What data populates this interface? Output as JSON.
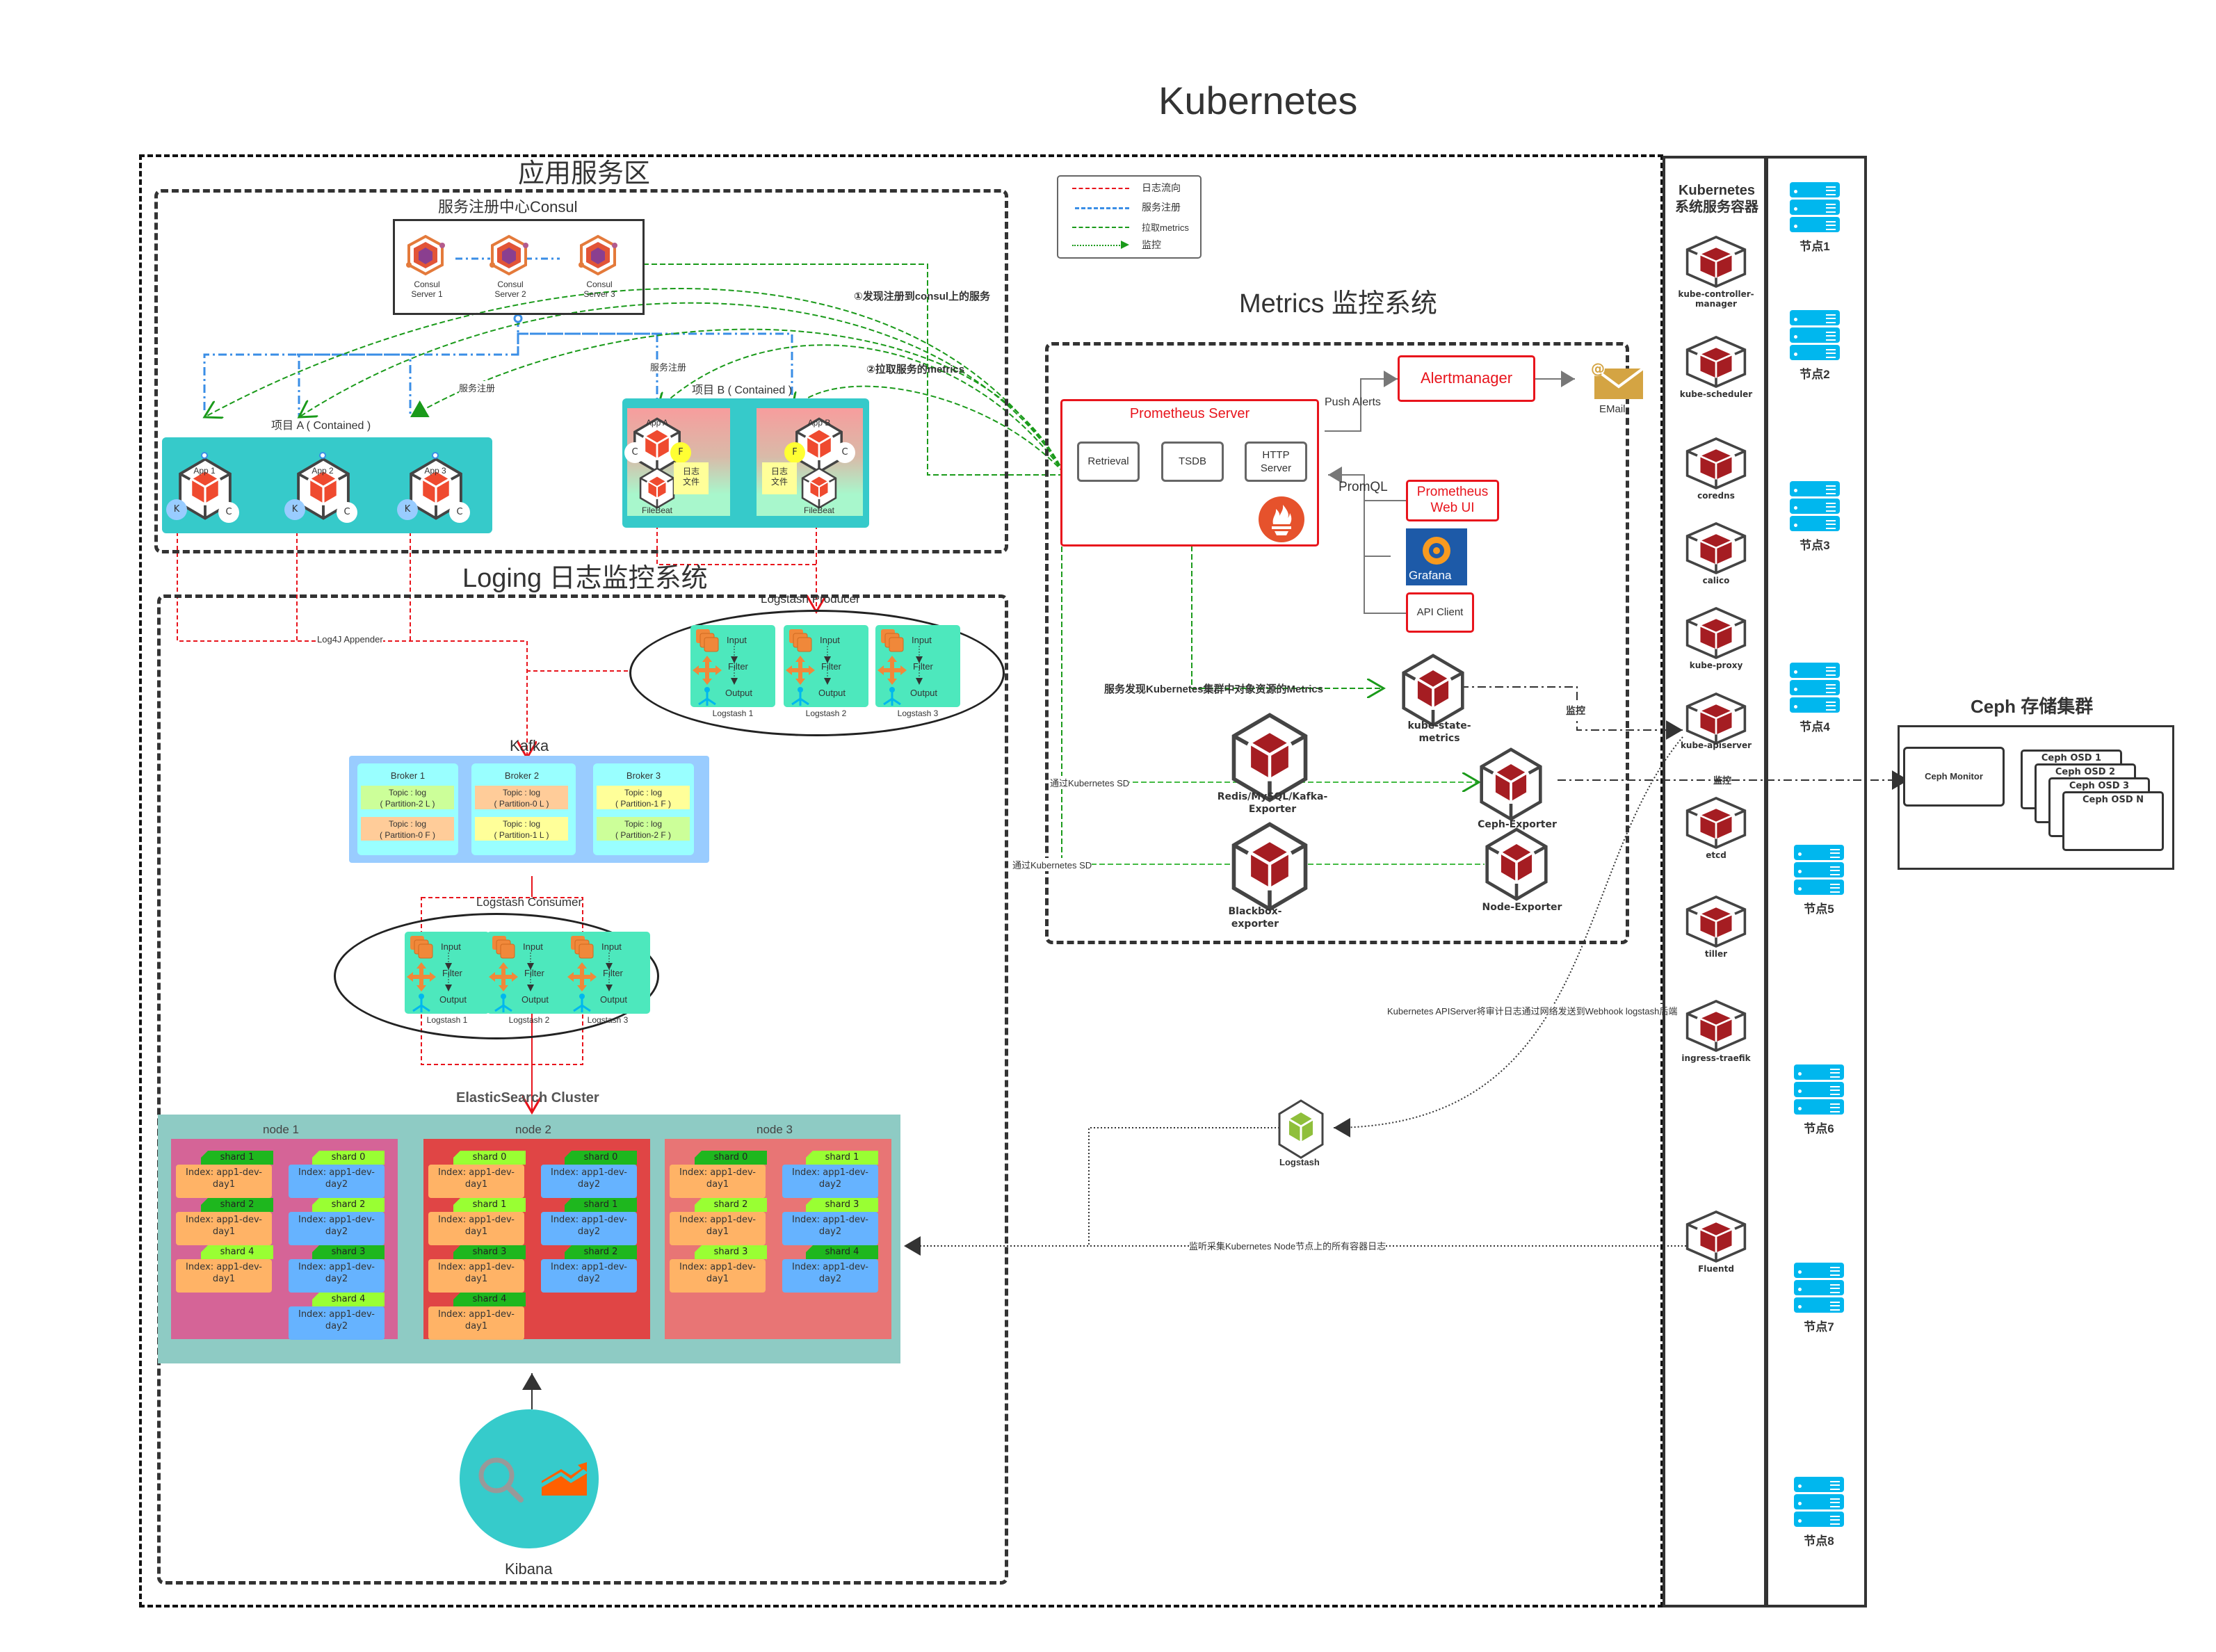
{
  "title": "Kubernetes",
  "legend": {
    "items": [
      {
        "label": "日志流向",
        "style": "red-dashed-arrow"
      },
      {
        "label": "服务注册",
        "style": "blue-dashdot-circles"
      },
      {
        "label": "拉取metrics",
        "style": "green-dashed-arrow"
      },
      {
        "label": "监控",
        "style": "green-dashdot-filled-arrow"
      }
    ]
  },
  "app_zone": {
    "title": "应用服务区",
    "consul": {
      "title": "服务注册中心Consul",
      "servers": [
        "Consul\nServer 1",
        "Consul\nServer 2",
        "Consul\nServer 3"
      ]
    },
    "register_label": "服务注册",
    "project_a": {
      "title": "项目 A ( Contained )",
      "apps": [
        "App 1",
        "App 2",
        "App 3"
      ],
      "badge_k": "K",
      "badge_c": "C"
    },
    "project_b": {
      "title": "项目 B ( Contained )",
      "apps": [
        "App A",
        "App B"
      ],
      "badge_c": "C",
      "badge_f": "F",
      "log_file": "日志\n文件",
      "filebeat": "FileBeat"
    },
    "annotation_1": "①发现注册到consul上的服务",
    "annotation_2": "②拉取服务的metrics"
  },
  "logging": {
    "title": "Loging 日志监控系统",
    "log4j": "Log4J Appender",
    "producer": {
      "title": "Logstash Producer",
      "instances": [
        "Logstash 1",
        "Logstash 2",
        "Logstash 3"
      ]
    },
    "pipeline": {
      "input": "Input",
      "filter": "Filter",
      "output": "Output"
    },
    "kafka": {
      "title": "Kafka",
      "brokers": [
        {
          "name": "Broker 1",
          "topics": [
            {
              "text": "Topic : log\n( Partition-2 L )",
              "color": "#ccff99"
            },
            {
              "text": "Topic : log\n( Partition-0 F )",
              "color": "#ffcc99"
            }
          ]
        },
        {
          "name": "Broker 2",
          "topics": [
            {
              "text": "Topic : log\n( Partition-0 L )",
              "color": "#ffcc99"
            },
            {
              "text": "Topic : log\n( Partition-1 L )",
              "color": "#ffff99"
            }
          ]
        },
        {
          "name": "Broker 3",
          "topics": [
            {
              "text": "Topic : log\n( Partition-1 F )",
              "color": "#ffff99"
            },
            {
              "text": "Topic : log\n( Partition-2 F )",
              "color": "#ccff99"
            }
          ]
        }
      ]
    },
    "consumer": {
      "title": "Logstash Consumer",
      "instances": [
        "Logstash 1",
        "Logstash 2",
        "Logstash 3"
      ]
    },
    "elasticsearch": {
      "title": "ElasticSearch Cluster",
      "nodes": [
        {
          "name": "node 1",
          "bg": "#d56497",
          "shards": [
            {
              "shard": "shard 1",
              "index": "Index: app1-dev-\nday1",
              "col": 0,
              "row": 0,
              "primary": true
            },
            {
              "shard": "shard 0",
              "index": "Index: app1-dev-\nday2",
              "col": 1,
              "row": 0,
              "primary": false
            },
            {
              "shard": "shard 2",
              "index": "Index: app1-dev-\nday1",
              "col": 0,
              "row": 1,
              "primary": true
            },
            {
              "shard": "shard 2",
              "index": "Index: app1-dev-\nday2",
              "col": 1,
              "row": 1,
              "primary": false
            },
            {
              "shard": "shard 4",
              "index": "Index: app1-dev-\nday1",
              "col": 0,
              "row": 2,
              "primary": false
            },
            {
              "shard": "shard 3",
              "index": "Index: app1-dev-\nday2",
              "col": 1,
              "row": 2,
              "primary": true
            },
            {
              "shard": "shard 4",
              "index": "Index: app1-dev-\nday2",
              "col": 1,
              "row": 3,
              "primary": false
            }
          ]
        },
        {
          "name": "node 2",
          "bg": "#e04545",
          "shards": [
            {
              "shard": "shard 0",
              "index": "Index: app1-dev-\nday1",
              "col": 0,
              "row": 0,
              "primary": false
            },
            {
              "shard": "shard 0",
              "index": "Index: app1-dev-\nday2",
              "col": 1,
              "row": 0,
              "primary": true
            },
            {
              "shard": "shard 1",
              "index": "Index: app1-dev-\nday1",
              "col": 0,
              "row": 1,
              "primary": false
            },
            {
              "shard": "shard 1",
              "index": "Index: app1-dev-\nday2",
              "col": 1,
              "row": 1,
              "primary": true
            },
            {
              "shard": "shard 3",
              "index": "Index: app1-dev-\nday1",
              "col": 0,
              "row": 2,
              "primary": true
            },
            {
              "shard": "shard 2",
              "index": "Index: app1-dev-\nday2",
              "col": 1,
              "row": 2,
              "primary": true
            },
            {
              "shard": "shard 4",
              "index": "Index: app1-dev-\nday1",
              "col": 0,
              "row": 3,
              "primary": true
            }
          ]
        },
        {
          "name": "node 3",
          "bg": "#e87575",
          "shards": [
            {
              "shard": "shard 0",
              "index": "Index: app1-dev-\nday1",
              "col": 0,
              "row": 0,
              "primary": true
            },
            {
              "shard": "shard 1",
              "index": "Index: app1-dev-\nday2",
              "col": 1,
              "row": 0,
              "primary": false
            },
            {
              "shard": "shard 2",
              "index": "Index: app1-dev-\nday1",
              "col": 0,
              "row": 1,
              "primary": false
            },
            {
              "shard": "shard 3",
              "index": "Index: app1-dev-\nday2",
              "col": 1,
              "row": 1,
              "primary": false
            },
            {
              "shard": "shard 3",
              "index": "Index: app1-dev-\nday1",
              "col": 0,
              "row": 2,
              "primary": false
            },
            {
              "shard": "shard 4",
              "index": "Index: app1-dev-\nday2",
              "col": 1,
              "row": 2,
              "primary": true
            }
          ]
        }
      ]
    },
    "kibana": "Kibana",
    "logstash_webhook": "Logstash",
    "audit_label": "Kubernetes APIServer将审计日志通过网络发送到Webhook logstash后端",
    "fluentd_label": "监听采集Kubernetes Node节点上的所有容器日志"
  },
  "metrics": {
    "title": "Metrics 监控系统",
    "prometheus": {
      "title": "Prometheus Server",
      "retrieval": "Retrieval",
      "tsdb": "TSDB",
      "http": "HTTP\nServer"
    },
    "push_alerts": "Push Alerts",
    "alertmanager": "Alertmanager",
    "email": "EMail",
    "promql": "PromQL",
    "web_ui": "Prometheus\nWeb UI",
    "grafana": "Grafana",
    "api_client": "API Client",
    "sd_k8s_objects": "服务发现Kubernetes集群中对象资源的Metrics",
    "kube_state_metrics": "kube-state-\nmetrics",
    "monitor_label": "监控",
    "sd_label_1": "通过Kubernetes SD",
    "sd_label_2": "通过Kubernetes SD",
    "exporters": {
      "redis": "Redis/MySQL/Kafka-\nExporter",
      "ceph": "Ceph-Exporter",
      "blackbox": "Blackbox-exporter",
      "node": "Node-Exporter"
    }
  },
  "system": {
    "title": "Kubernetes\n系统服务容器",
    "components": [
      "kube-controller-\nmanager",
      "kube-scheduler",
      "coredns",
      "calico",
      "kube-proxy",
      "kube-apiserver",
      "etcd",
      "tiller",
      "ingress-traefik",
      "Fluentd"
    ],
    "apiserver_monitor": "监控",
    "nodes": [
      "节点1",
      "节点2",
      "节点3",
      "节点4",
      "节点5",
      "节点6",
      "节点7",
      "节点8"
    ]
  },
  "ceph": {
    "title": "Ceph 存储集群",
    "monitor": "Ceph Monitor",
    "osds": [
      "Ceph OSD 1",
      "Ceph OSD 2",
      "Ceph OSD 3",
      "Ceph OSD N"
    ]
  }
}
